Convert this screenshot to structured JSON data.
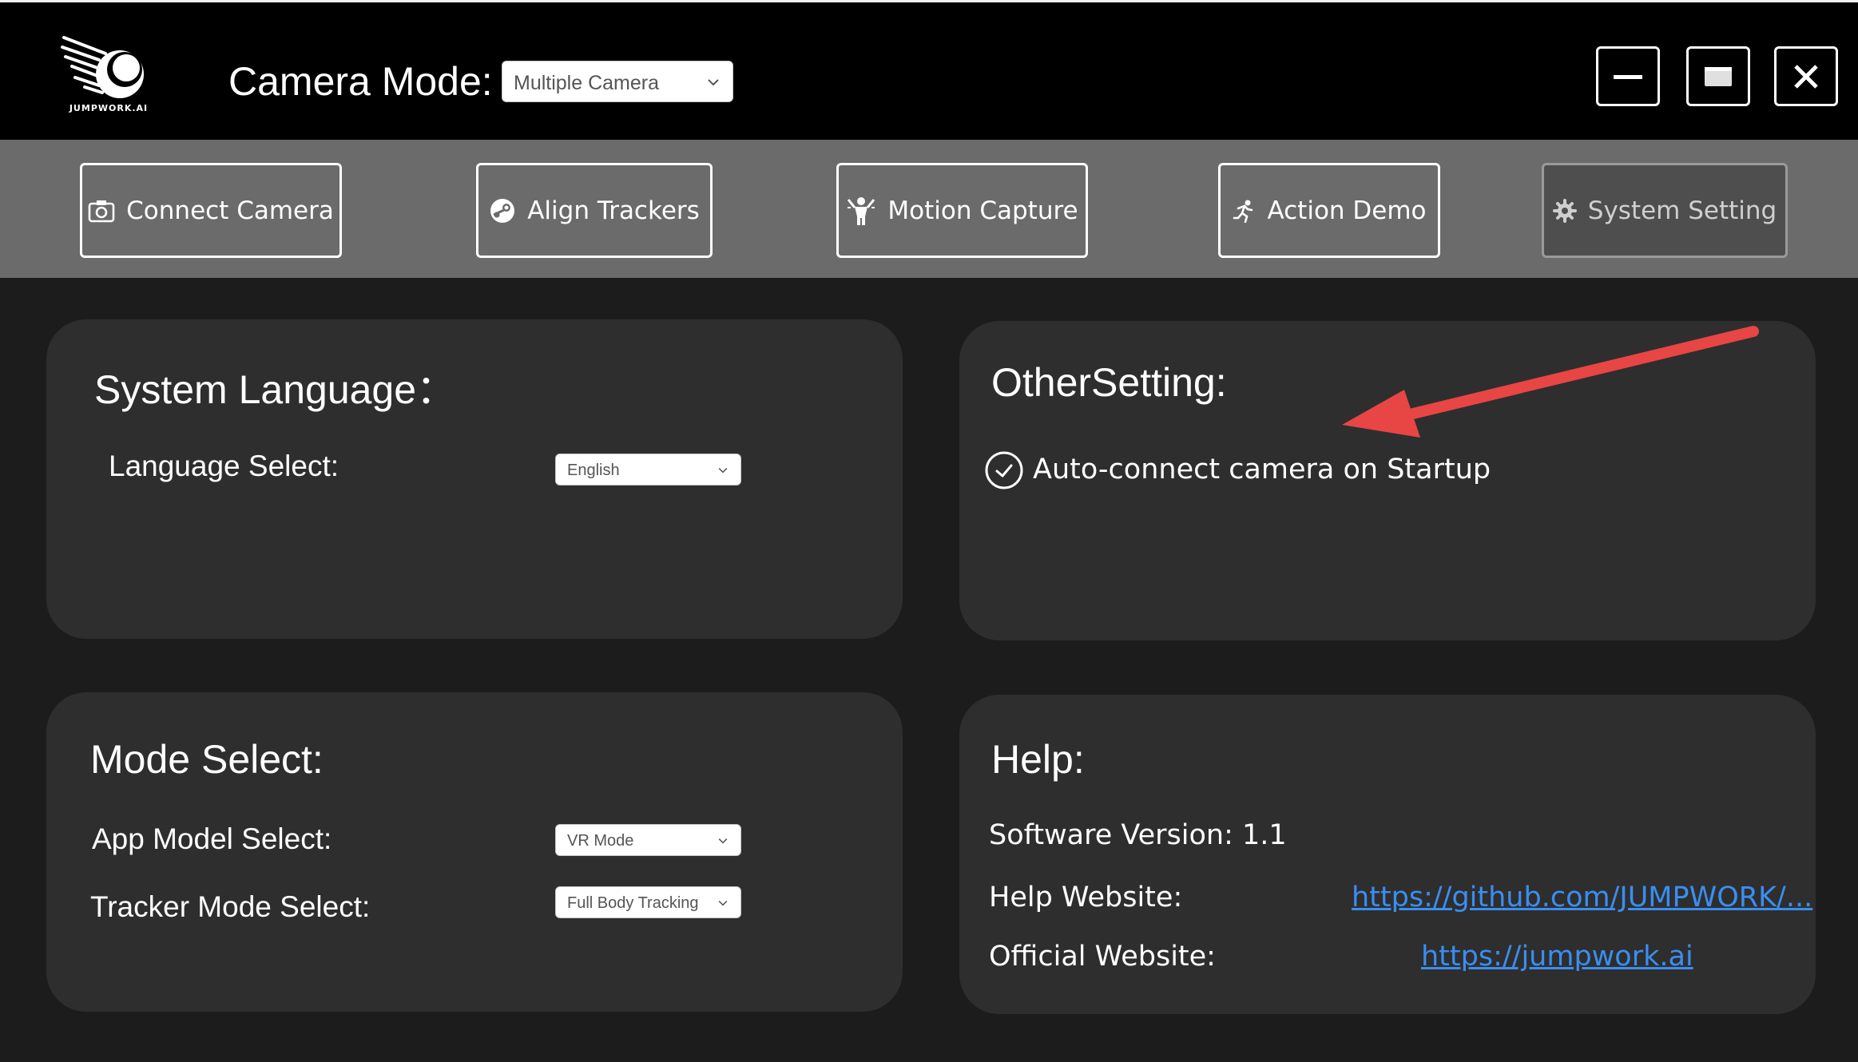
{
  "header": {
    "logo_text": "JUMPWORK.AI",
    "camera_mode_label": "Camera Mode:",
    "camera_mode_value": "Multiple Camera",
    "window_buttons": [
      "minimize-icon",
      "maximize-icon",
      "close-icon"
    ]
  },
  "toolbar": {
    "connect_camera": "Connect Camera",
    "align_trackers": "Align Trackers",
    "motion_capture": "Motion Capture",
    "action_demo": "Action Demo",
    "system_setting": "System Setting",
    "active_tab": "System Setting"
  },
  "language_panel": {
    "title": "System Language：",
    "language_label": "Language Select:",
    "language_value": "English"
  },
  "other_panel": {
    "title": "OtherSetting:",
    "auto_connect_label": "Auto-connect camera on Startup",
    "auto_connect_checked": true
  },
  "mode_panel": {
    "title": "Mode Select:",
    "app_model_label": "App Model Select:",
    "app_model_value": "VR Mode",
    "tracker_mode_label": "Tracker Mode Select:",
    "tracker_mode_value": "Full Body Tracking"
  },
  "help_panel": {
    "title": "Help:",
    "software_version": "Software Version: 1.1",
    "help_website_label": "Help Website:",
    "help_website_link": "https://github.com/JUMPWORK/...",
    "official_website_label": "Official Website:",
    "official_website_link": "https://jumpwork.ai"
  },
  "colors": {
    "titlebar": "#000000",
    "toolbar": "#6b6b6b",
    "background": "#1c1c1c",
    "panel": "#2e2e2e",
    "link": "#3a8ef0",
    "annotation_arrow": "#e84545"
  }
}
